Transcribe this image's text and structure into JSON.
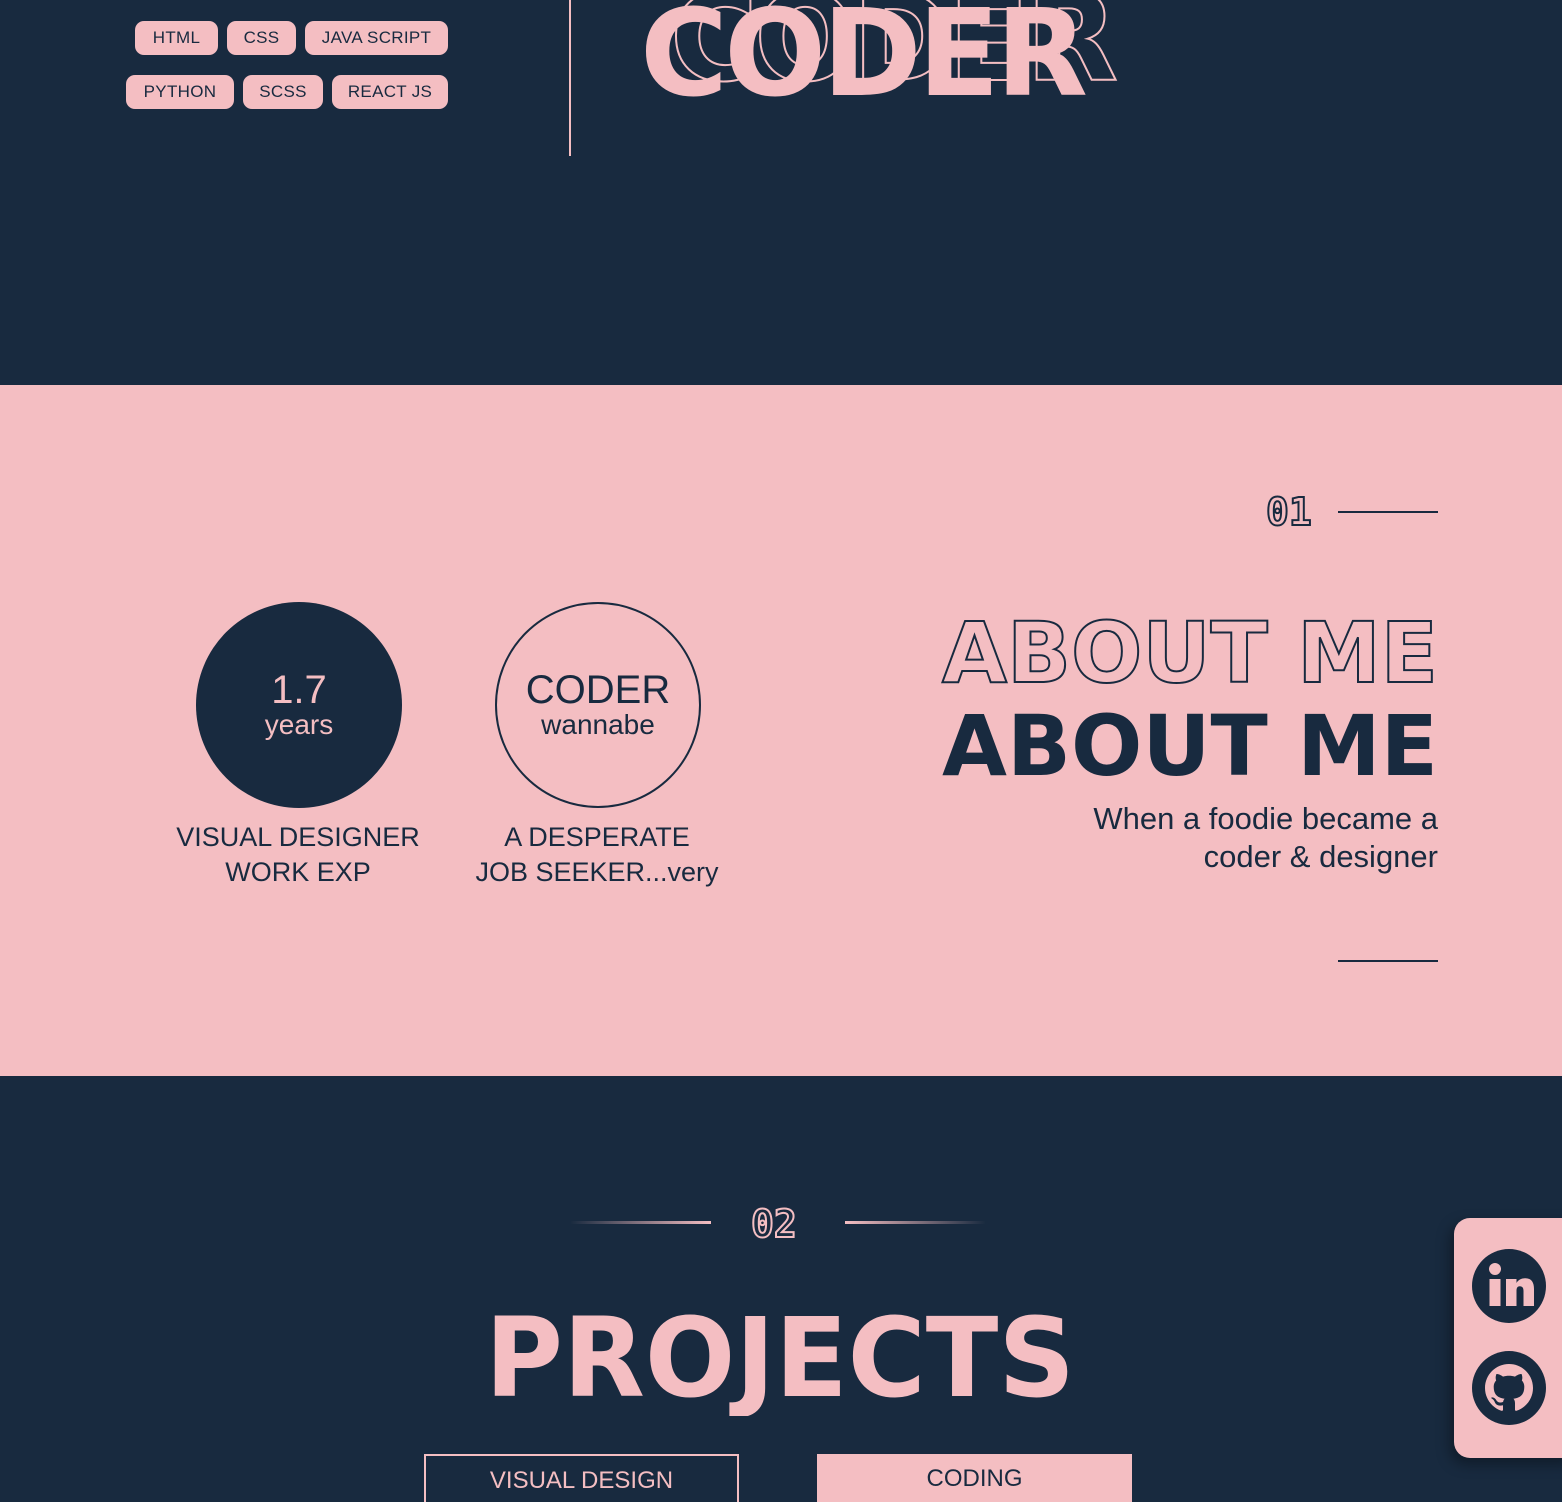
{
  "colors": {
    "navy": "#182a3f",
    "pink": "#f4bec2"
  },
  "hero": {
    "skills": [
      "HTML",
      "CSS",
      "JAVA SCRIPT",
      "PYTHON",
      "SCSS",
      "REACT JS"
    ],
    "headline": "CODER"
  },
  "about": {
    "section_number": "01",
    "title_outline": "ABOUT ME",
    "title_solid": "ABOUT ME",
    "subtitle_line1": "When a foodie became a",
    "subtitle_line2": "coder & designer",
    "stats": [
      {
        "big": "1.7",
        "small": "years",
        "caption_line1": "VISUAL DESIGNER",
        "caption_line2": "WORK EXP"
      },
      {
        "big": "CODER",
        "small": "wannabe",
        "caption_line1": "A DESPERATE",
        "caption_line2": "JOB SEEKER...very"
      }
    ]
  },
  "projects": {
    "section_number": "02",
    "title": "PROJECTS",
    "tabs": [
      "VISUAL DESIGN",
      "CODING"
    ]
  },
  "social": [
    {
      "name": "LinkedIn",
      "icon": "linkedin-icon"
    },
    {
      "name": "GitHub",
      "icon": "github-icon"
    }
  ]
}
